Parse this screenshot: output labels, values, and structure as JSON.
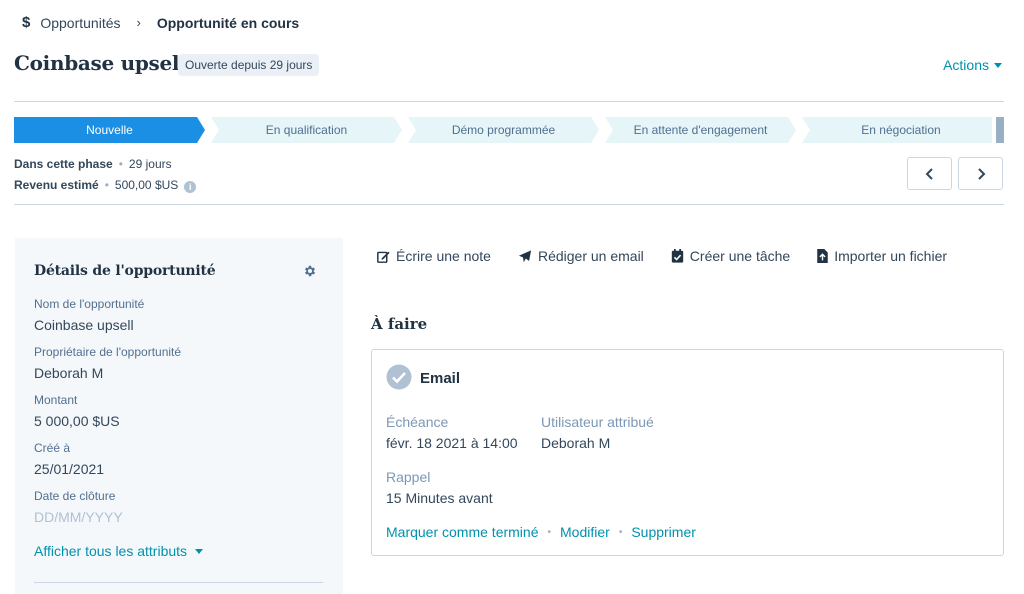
{
  "breadcrumb": {
    "icon": "dollar-icon",
    "parent": "Opportunités",
    "current": "Opportunité en cours"
  },
  "header": {
    "title": "Coinbase upsell",
    "age_badge": "Ouverte depuis 29 jours",
    "actions_label": "Actions"
  },
  "pipeline": {
    "active_color": "#1a8fe3",
    "stages": [
      {
        "label": "Nouvelle",
        "active": true
      },
      {
        "label": "En qualification",
        "active": false
      },
      {
        "label": "Démo programmée",
        "active": false
      },
      {
        "label": "En attente d'engagement",
        "active": false
      },
      {
        "label": "En négociation",
        "active": false
      }
    ]
  },
  "phase": {
    "in_phase_label": "Dans cette phase",
    "in_phase_value": "29 jours",
    "revenue_label": "Revenu estimé",
    "revenue_value": "500,00 $US"
  },
  "details": {
    "title": "Détails de l'opportunité",
    "fields": [
      {
        "label": "Nom de l'opportunité",
        "value": "Coinbase upsell"
      },
      {
        "label": "Propriétaire de l'opportunité",
        "value": "Deborah M"
      },
      {
        "label": "Montant",
        "value": "5 000,00 $US"
      },
      {
        "label": "Créé à",
        "value": "25/01/2021"
      },
      {
        "label": "Date de clôture",
        "placeholder": "DD/MM/YYYY"
      }
    ],
    "show_all": "Afficher tous les attributs"
  },
  "toolbar": {
    "note": "Écrire une note",
    "email": "Rédiger un email",
    "task": "Créer une tâche",
    "file": "Importer un fichier"
  },
  "todo": {
    "title": "À faire",
    "card": {
      "type": "Email",
      "due_label": "Échéance",
      "due_value": "févr. 18 2021 à 14:00",
      "assignee_label": "Utilisateur attribué",
      "assignee_value": "Deborah M",
      "reminder_label": "Rappel",
      "reminder_value": "15 Minutes avant",
      "mark_done": "Marquer comme terminé",
      "edit": "Modifier",
      "delete": "Supprimer"
    }
  }
}
